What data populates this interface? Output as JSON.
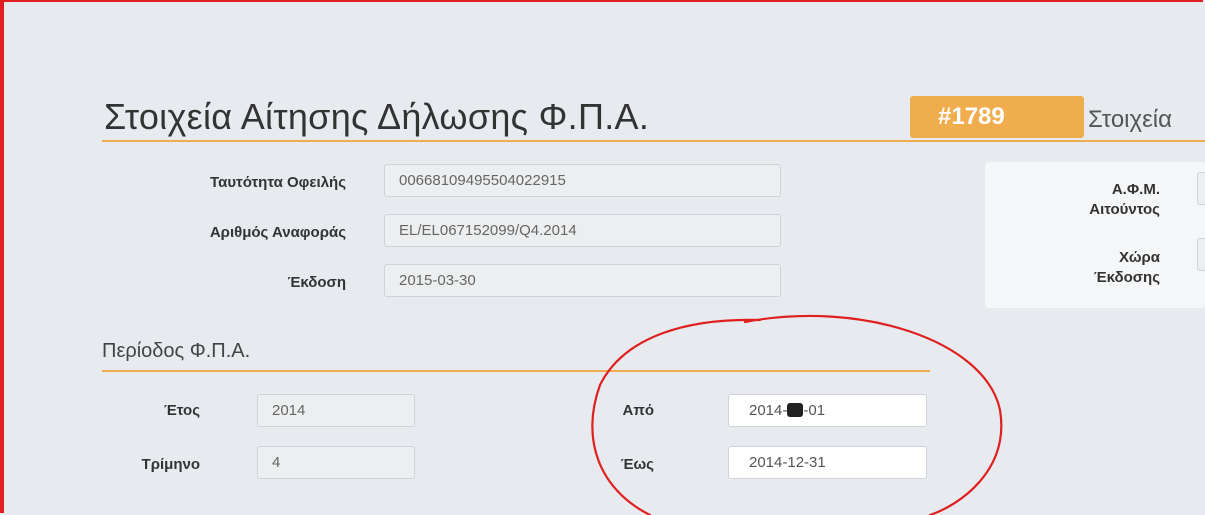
{
  "header": {
    "title": "Στοιχεία Αίτησης Δήλωσης Φ.Π.Α.",
    "badge": "#1789",
    "subtitle_partial": "Στοιχεία"
  },
  "request": {
    "debt_id_label": "Ταυτότητα Οφειλής",
    "debt_id_value": "00668109495504022915",
    "reference_label": "Αριθμός Αναφοράς",
    "reference_value": "EL/EL067152099/Q4.2014",
    "issue_label": "Έκδοση",
    "issue_value": "2015-03-30"
  },
  "applicant": {
    "afm_label_line1": "Α.Φ.Μ.",
    "afm_label_line2": "Αιτούντος",
    "country_label_line1": "Χώρα",
    "country_label_line2": "Έκδοσης"
  },
  "vat_period": {
    "section_title": "Περίοδος Φ.Π.Α.",
    "year_label": "Έτος",
    "year_value": "2014",
    "quarter_label": "Τρίμηνο",
    "quarter_value": "4",
    "from_label": "Από",
    "from_value": "2014-",
    "from_value_suffix": "-01",
    "to_label": "Έως",
    "to_value": "2014-12-31"
  },
  "colors": {
    "accent": "#f0ad4e",
    "annotation": "#e02020",
    "background": "#e7eaee"
  }
}
